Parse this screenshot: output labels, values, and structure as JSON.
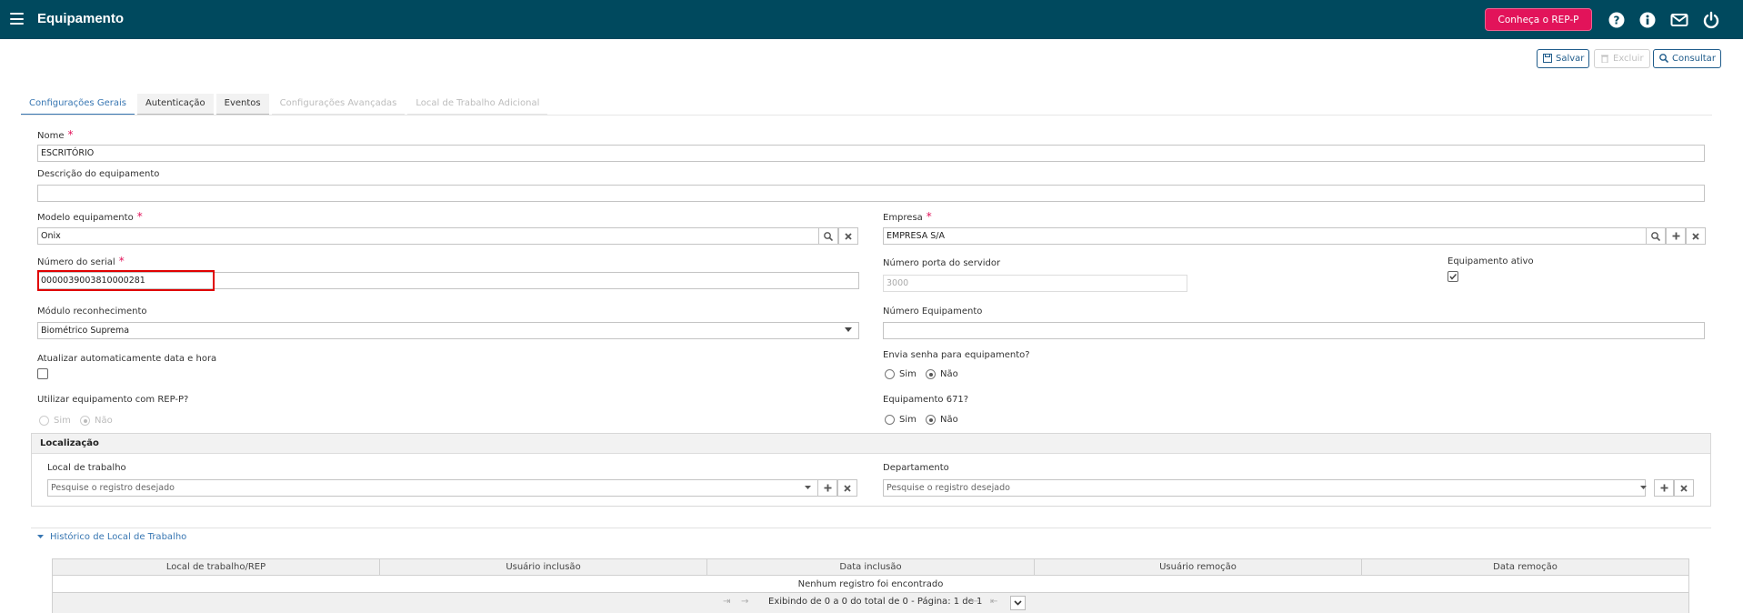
{
  "header": {
    "title": "Equipamento",
    "rep_button": "Conheça o REP-P",
    "bg_color": "#00495e",
    "accent_color": "#e2135a"
  },
  "toolbar": {
    "save": "Salvar",
    "delete": "Excluir",
    "query": "Consultar"
  },
  "tabs": [
    "Configurações Gerais",
    "Autenticação",
    "Eventos",
    "Configurações Avançadas",
    "Local de Trabalho Adicional"
  ],
  "form": {
    "nome_label": "Nome",
    "nome_value": "ESCRITÓRIO",
    "descricao_label": "Descrição do equipamento",
    "descricao_value": "",
    "modelo_label": "Modelo equipamento",
    "modelo_value": "Onix",
    "empresa_label": "Empresa",
    "empresa_value": "EMPRESA S/A",
    "serial_label": "Número do serial",
    "serial_value": "0000039003810000281",
    "porta_label": "Número porta do servidor",
    "porta_value": "3000",
    "ativo_label": "Equipamento ativo",
    "modulo_label": "Módulo reconhecimento",
    "modulo_value": "Biométrico Suprema",
    "numero_equip_label": "Número Equipamento",
    "numero_equip_value": "",
    "atualizar_label": "Atualizar automaticamente data e hora",
    "envia_senha_label": "Envia senha para equipamento?",
    "rep_p_label": "Utilizar equipamento com REP-P?",
    "eq671_label": "Equipamento 671?",
    "sim": "Sim",
    "nao": "Não"
  },
  "localizacao": {
    "title": "Localização",
    "local_label": "Local de trabalho",
    "local_placeholder": "Pesquise o registro desejado",
    "departamento_label": "Departamento",
    "departamento_placeholder": "Pesquise o registro desejado"
  },
  "historico": {
    "link": "Histórico de Local de Trabalho",
    "columns": [
      "Local de trabalho/REP",
      "Usuário inclusão",
      "Data inclusão",
      "Usuário remoção",
      "Data remoção"
    ],
    "empty": "Nenhum registro foi encontrado",
    "pager_text": "Exibindo de 0 a 0 do total de 0 - Página: 1 de 1"
  }
}
